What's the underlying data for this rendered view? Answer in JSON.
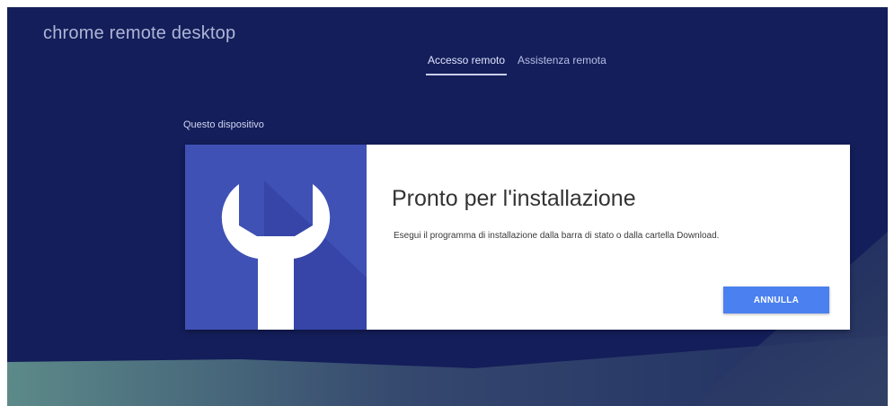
{
  "app": {
    "title": "chrome remote desktop"
  },
  "tabs": [
    {
      "label": "Accesso remoto",
      "active": true
    },
    {
      "label": "Assistenza remota",
      "active": false
    }
  ],
  "section": {
    "label": "Questo dispositivo"
  },
  "card": {
    "title": "Pronto per l'installazione",
    "description": "Esegui il programma di installazione dalla barra di stato o dalla cartella Download.",
    "cancel_label": "ANNULLA",
    "icon": "wrench-icon"
  },
  "colors": {
    "background": "#141e5a",
    "accent": "#3f51b5",
    "button": "#4a80f0",
    "card": "#ffffff"
  }
}
